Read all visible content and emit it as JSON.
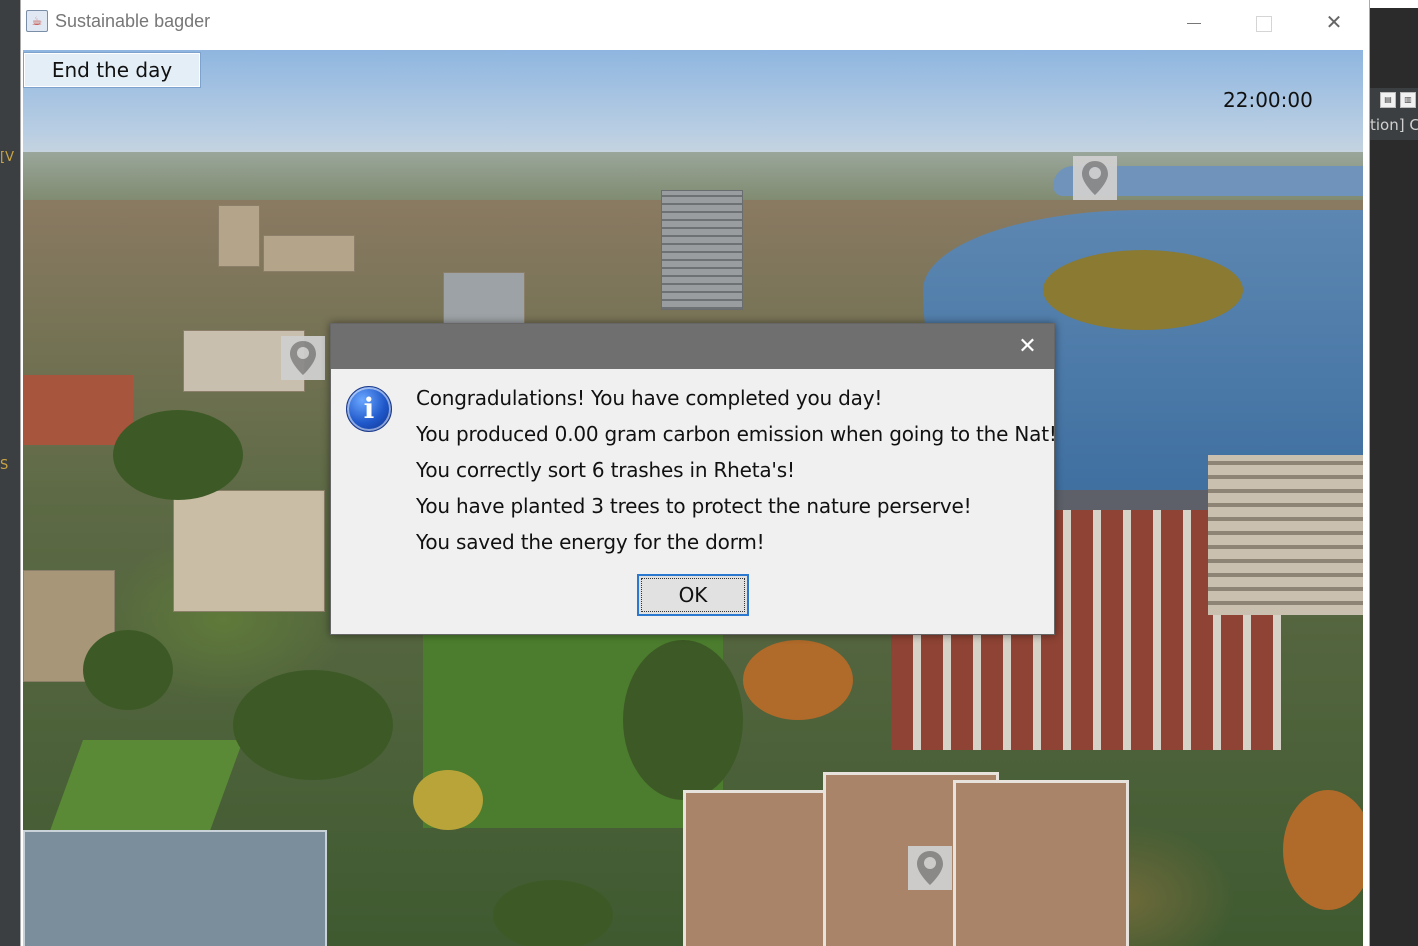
{
  "window": {
    "title": "Sustainable bagder",
    "controls": {
      "minimize": "minimize",
      "maximize": "maximize",
      "close": "close"
    }
  },
  "toolbar": {
    "end_day_label": "End the day"
  },
  "clock": "22:00:00",
  "dialog": {
    "icon": "info-icon",
    "lines": [
      "Congradulations! You have completed you day!",
      "You produced 0.00 gram carbon emission when going to the Nat!",
      "You correctly sort 6 trashes in Rheta's!",
      "You have planted 3 trees to protect the nature perserve!",
      "You saved the energy for the dorm!"
    ],
    "ok_label": "OK"
  },
  "background_ide": {
    "right_text": "tion] C"
  }
}
